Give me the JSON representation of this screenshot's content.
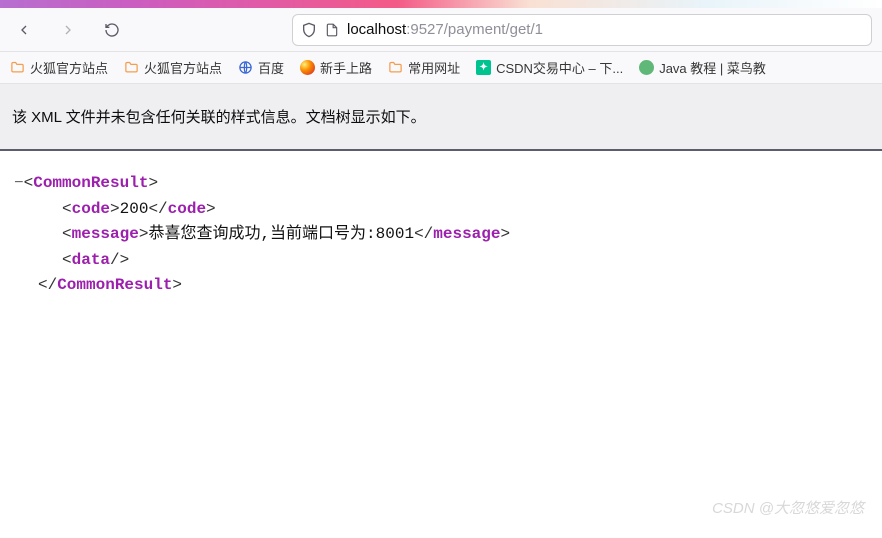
{
  "url": {
    "host": "localhost",
    "port": ":9527",
    "path": "/payment/get/1"
  },
  "bookmarks": {
    "i0": "火狐官方站点",
    "i1": "火狐官方站点",
    "i2": "百度",
    "i3": "新手上路",
    "i4": "常用网址",
    "i5": "CSDN交易中心 – 下...",
    "i6": "Java 教程 | 菜鸟教"
  },
  "notice": "该 XML 文件并未包含任何关联的样式信息。文档树显示如下。",
  "xml": {
    "root": "CommonResult",
    "code_tag": "code",
    "code_val": "200",
    "msg_tag": "message",
    "msg_val": "恭喜您查询成功,当前端口号为:8001",
    "data_tag": "data"
  },
  "watermark": "CSDN @大忽悠爱忽悠"
}
